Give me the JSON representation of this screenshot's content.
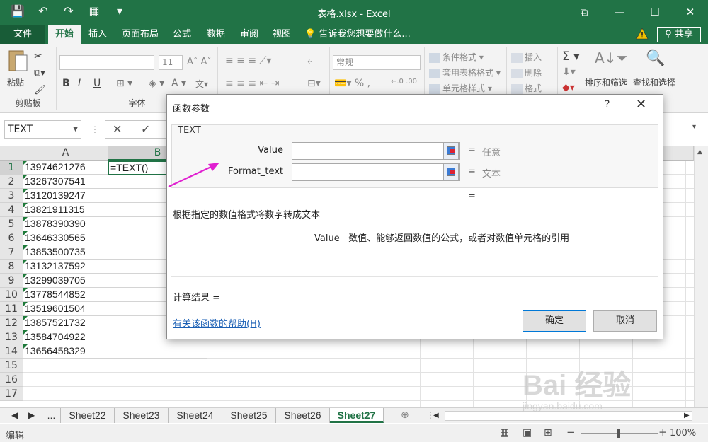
{
  "window": {
    "title": "表格.xlsx - Excel",
    "buttons": [
      "⧉",
      "—",
      "☐",
      "✕"
    ]
  },
  "qat": [
    "💾",
    "↶",
    "↷",
    "▦",
    "▾"
  ],
  "menu": {
    "file": "文件",
    "tabs": [
      "开始",
      "插入",
      "页面布局",
      "公式",
      "数据",
      "审阅",
      "视图"
    ],
    "active_tab": "开始",
    "tell_me": "告诉我您想要做什么...",
    "share": "共享"
  },
  "ribbon": {
    "clipboard": {
      "paste": "粘贴",
      "label": "剪贴板"
    },
    "font": {
      "size": "11",
      "label": "字体",
      "bold": "B",
      "italic": "I",
      "underline": "U"
    },
    "number": {
      "format": "常规"
    },
    "styles": {
      "conditional": "条件格式",
      "table": "套用表格格式",
      "cell": "单元格样式"
    },
    "cells": {
      "insert": "插入",
      "delete": "删除",
      "format": "格式"
    },
    "editing": {
      "sort": "排序和筛选",
      "find": "查找和选择"
    }
  },
  "formula_bar": {
    "name_box": "TEXT",
    "cancel": "✕",
    "enter": "✓"
  },
  "grid": {
    "columns": [
      "A",
      "B"
    ],
    "selected_column": "B",
    "rows": [
      "1",
      "2",
      "3",
      "4",
      "5",
      "6",
      "7",
      "8",
      "9",
      "10",
      "11",
      "12",
      "13",
      "14",
      "15",
      "16",
      "17"
    ],
    "selected_row": "1",
    "column_a": [
      "13974621276",
      "13267307541",
      "13120139247",
      "13821911315",
      "13878390390",
      "13646330565",
      "13853500735",
      "13132137592",
      "13299039705",
      "13778544852",
      "13519601504",
      "13857521732",
      "13584704922",
      "13656458329"
    ],
    "active_cell_value": "=TEXT()"
  },
  "sheets": {
    "tabs": [
      "...",
      "Sheet22",
      "Sheet23",
      "Sheet24",
      "Sheet25",
      "Sheet26",
      "Sheet27"
    ],
    "active": "Sheet27",
    "add": "⊕"
  },
  "status": {
    "mode": "编辑",
    "zoom": "100%"
  },
  "dialog": {
    "title": "函数参数",
    "help": "?",
    "close": "✕",
    "function_name": "TEXT",
    "args": [
      {
        "label": "Value",
        "eq": "=",
        "value": "任意"
      },
      {
        "label": "Format_text",
        "eq": "=",
        "value": "文本"
      }
    ],
    "result_eq": "=",
    "description": "根据指定的数值格式将数字转成文本",
    "arg_name": "Value",
    "arg_desc": "数值、能够返回数值的公式，或者对数值单元格的引用",
    "result_label": "计算结果 =",
    "help_link": "有关该函数的帮助(H)",
    "ok": "确定",
    "cancel": "取消"
  },
  "colors": {
    "excel_green": "#217346",
    "annotation_arrow": "#e020d0"
  },
  "watermark": {
    "main": "Bai 经验",
    "sub": "jingyan.baidu.com"
  }
}
